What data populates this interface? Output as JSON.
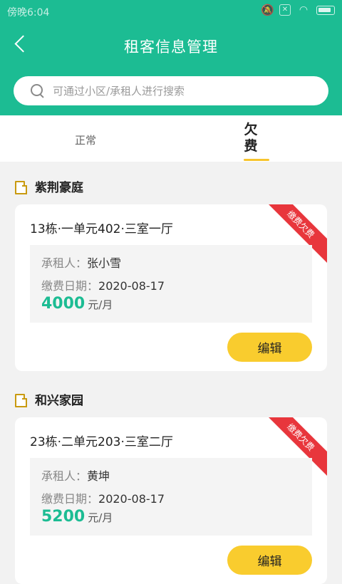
{
  "status_bar": {
    "time": "傍晚6:04"
  },
  "header": {
    "title": "租客信息管理"
  },
  "search": {
    "placeholder": "可通过小区/承租人进行搜索"
  },
  "tabs": [
    {
      "label": "正常",
      "active": false
    },
    {
      "label": "欠费",
      "active": true
    }
  ],
  "groups": [
    {
      "name": "紫荆豪庭",
      "card": {
        "unit": "13栋·一单元402·三室一厅",
        "badge": "缴费欠费",
        "tenant_label": "承租人：",
        "tenant": "张小雪",
        "date_label": "缴费日期：",
        "date": "2020-08-17",
        "rent": "4000",
        "rent_unit": "元/月",
        "edit_label": "编辑"
      }
    },
    {
      "name": "和兴家园",
      "card": {
        "unit": "23栋·二单元203·三室二厅",
        "badge": "缴费欠费",
        "tenant_label": "承租人：",
        "tenant": "黄坤",
        "date_label": "缴费日期：",
        "date": "2020-08-17",
        "rent": "5200",
        "rent_unit": "元/月",
        "edit_label": "编辑"
      }
    }
  ],
  "colors": {
    "primary": "#1cbc93",
    "accent": "#f9cc2e",
    "badge": "#e8363c"
  }
}
